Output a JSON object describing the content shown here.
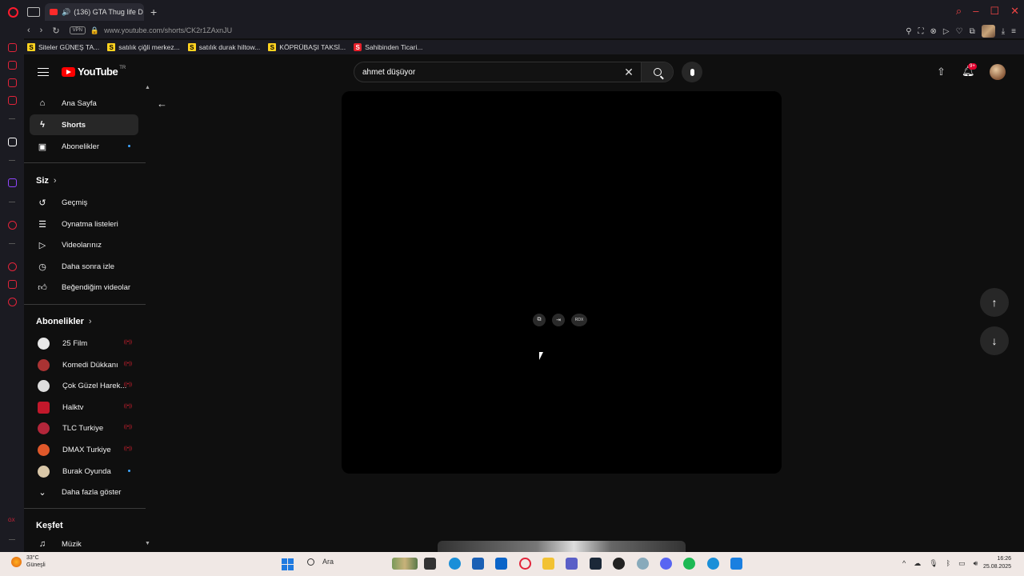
{
  "browser": {
    "tab_title": "(136) GTA Thug life D",
    "url": "www.youtube.com/shorts/CK2r1ZAxnJU",
    "vpn_label": "VPN",
    "bookmarks": [
      {
        "label": "Siteler GÜNEŞ TA...",
        "icon": "S"
      },
      {
        "label": "satılık çiğli merkez...",
        "icon": "S"
      },
      {
        "label": "satılık durak hiltow...",
        "icon": "S"
      },
      {
        "label": "KÖPRÜBAŞI TAKSİ...",
        "icon": "S"
      },
      {
        "label": "Sahibinden Ticari...",
        "icon": "S"
      }
    ]
  },
  "youtube": {
    "logo_text": "YouTube",
    "logo_country": "TR",
    "search_value": "ahmet düşüyor",
    "notification_badge": "9+",
    "sidebar": {
      "main": [
        {
          "label": "Ana Sayfa",
          "icon": "home-icon"
        },
        {
          "label": "Shorts",
          "icon": "shorts-icon",
          "active": true
        },
        {
          "label": "Abonelikler",
          "icon": "subscriptions-icon"
        }
      ],
      "you_header": "Siz",
      "you": [
        {
          "label": "Geçmiş",
          "icon": "history-icon"
        },
        {
          "label": "Oynatma listeleri",
          "icon": "playlist-icon"
        },
        {
          "label": "Videolarınız",
          "icon": "your-videos-icon"
        },
        {
          "label": "Daha sonra izle",
          "icon": "watch-later-icon"
        },
        {
          "label": "Beğendiğim videolar",
          "icon": "liked-icon"
        }
      ],
      "subs_header": "Abonelikler",
      "subs": [
        {
          "label": "25 Film",
          "color": "#e8e8e8",
          "status": "live"
        },
        {
          "label": "Komedi Dükkanı",
          "color": "#a33",
          "status": "live"
        },
        {
          "label": "Çok Güzel Harek...",
          "color": "#ddd",
          "status": "live"
        },
        {
          "label": "Halktv",
          "color": "#c2182b",
          "status": "live"
        },
        {
          "label": "TLC Turkiye",
          "color": "#b3263a",
          "status": "live"
        },
        {
          "label": "DMAX Turkiye",
          "color": "#e0582a",
          "status": "live"
        },
        {
          "label": "Burak Oyunda",
          "color": "#d9c7a8",
          "status": "new"
        }
      ],
      "show_more": "Daha fazla göster",
      "explore_header": "Keşfet",
      "explore": [
        {
          "label": "Müzik",
          "icon": "music-icon"
        }
      ]
    },
    "video_controls": {
      "rdx_label": "RDX"
    }
  },
  "taskbar": {
    "temperature": "33°C",
    "weather_text": "Güneşli",
    "search_label": "Ara",
    "time": "16:26",
    "date": "25.08.2025"
  },
  "colors": {
    "accent": "#ff0000",
    "opera": "#e2243a",
    "background": "#0f0f0f"
  }
}
